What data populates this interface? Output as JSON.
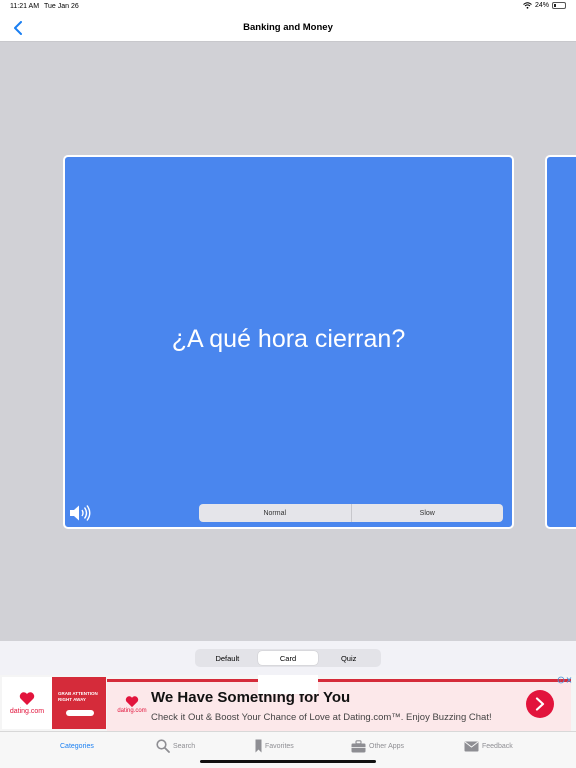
{
  "status_bar": {
    "time": "11:21 AM",
    "date": "Tue Jan 26",
    "battery": "24%",
    "battery_level": 0.24
  },
  "nav": {
    "title": "Banking and Money"
  },
  "card": {
    "phrase": "¿A qué hora cierran?",
    "speed_options": [
      "Normal",
      "Slow"
    ]
  },
  "modes": {
    "options": [
      "Default",
      "Card",
      "Quiz"
    ],
    "selected": "Card"
  },
  "ad": {
    "thumb_logo": "dating.com",
    "thumb_text": "GRAB ATTENTION RIGHT AWAY",
    "logo": "dating.com",
    "headline": "We Have Something for You",
    "subline": "Check it Out & Boost Your Chance of Love at Dating.com™. Enjoy Buzzing Chat!"
  },
  "tabs": [
    {
      "label": "Categories",
      "icon": "categories-icon",
      "active": true
    },
    {
      "label": "Search",
      "icon": "search-icon"
    },
    {
      "label": "Favorites",
      "icon": "bookmark-icon"
    },
    {
      "label": "Other Apps",
      "icon": "briefcase-icon"
    },
    {
      "label": "Feedback",
      "icon": "envelope-icon"
    }
  ],
  "colors": {
    "accent": "#1a7ff2",
    "card": "#4a86ee",
    "ad_red": "#e2143c"
  }
}
